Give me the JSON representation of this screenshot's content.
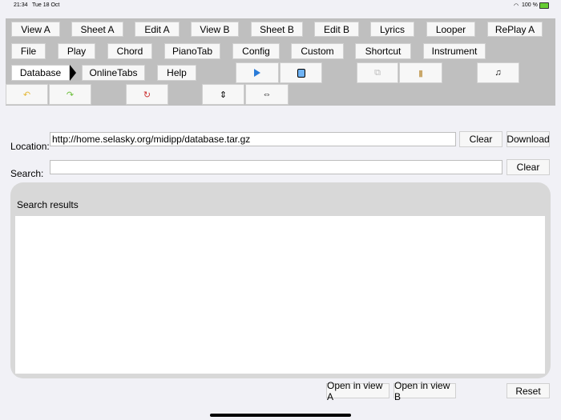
{
  "status": {
    "time": "21:34",
    "date": "Tue 18 Oct",
    "battery": "100 %"
  },
  "toolbar": {
    "row1": [
      "View A",
      "Sheet A",
      "Edit A",
      "View B",
      "Sheet B",
      "Edit B",
      "Lyrics",
      "Looper",
      "RePlay A"
    ],
    "row2": [
      "File",
      "Play",
      "Chord",
      "PianoTab",
      "Config",
      "Custom",
      "Shortcut",
      "Instrument"
    ],
    "row3": [
      "Database",
      "OnlineTabs",
      "Help"
    ]
  },
  "location": {
    "label": "Location:",
    "value": "http://home.selasky.org/midipp/database.tar.gz",
    "clear": "Clear",
    "download": "Download"
  },
  "search": {
    "label": "Search:",
    "value": "",
    "clear": "Clear"
  },
  "results": {
    "title": "Search results"
  },
  "bottom": {
    "open_a": "Open in view A",
    "open_b": "Open in view B",
    "reset": "Reset"
  }
}
